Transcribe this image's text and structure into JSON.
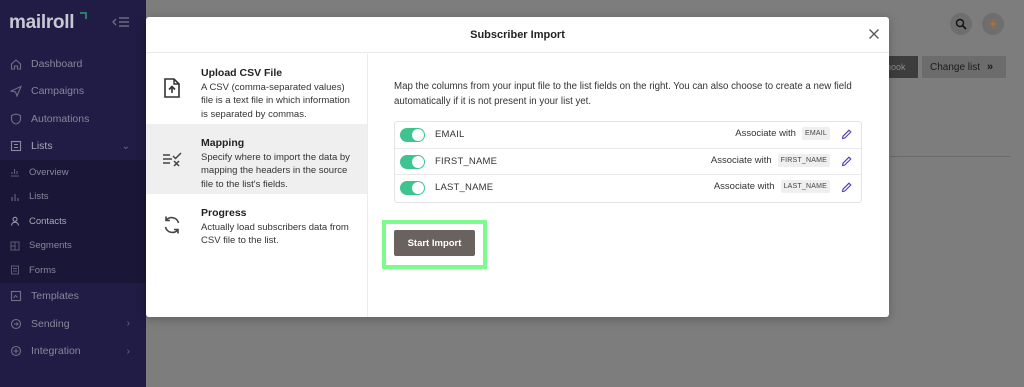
{
  "brand": {
    "name": "mailroll"
  },
  "sidebar": {
    "items": [
      {
        "label": "Dashboard",
        "icon": "home-icon"
      },
      {
        "label": "Campaigns",
        "icon": "send-icon"
      },
      {
        "label": "Automations",
        "icon": "shield-icon"
      },
      {
        "label": "Lists",
        "icon": "list-icon",
        "expanded": true
      }
    ],
    "sub_items": [
      {
        "label": "Overview",
        "icon": "chart-icon"
      },
      {
        "label": "Lists",
        "icon": "bar-icon"
      },
      {
        "label": "Contacts",
        "icon": "user-icon"
      },
      {
        "label": "Segments",
        "icon": "segment-icon"
      },
      {
        "label": "Forms",
        "icon": "form-icon"
      }
    ],
    "bottom_items": [
      {
        "label": "Templates",
        "icon": "template-icon"
      },
      {
        "label": "Sending",
        "icon": "sending-icon"
      },
      {
        "label": "Integration",
        "icon": "plug-icon"
      }
    ]
  },
  "background": {
    "change_list_label": "Change list",
    "dark_button_label": "hook"
  },
  "modal": {
    "title": "Subscriber Import",
    "steps": [
      {
        "title": "Upload CSV File",
        "desc": "A CSV (comma-separated values) file is a text file in which information is separated by commas.",
        "icon": "upload-file-icon"
      },
      {
        "title": "Mapping",
        "desc": "Specify where to import the data by mapping the headers in the source file to the list's fields.",
        "icon": "mapping-icon"
      },
      {
        "title": "Progress",
        "desc": "Actually load subscribers data from CSV file to the list.",
        "icon": "refresh-icon"
      }
    ],
    "intro": "Map the columns from your input file to the list fields on the right. You can also choose to create a new field automatically if it is not present in your list yet.",
    "fields": [
      {
        "name": "EMAIL",
        "associate_label": "Associate with",
        "tag": "EMAIL",
        "enabled": true
      },
      {
        "name": "FIRST_NAME",
        "associate_label": "Associate with",
        "tag": "FIRST_NAME",
        "enabled": true
      },
      {
        "name": "LAST_NAME",
        "associate_label": "Associate with",
        "tag": "LAST_NAME",
        "enabled": true
      }
    ],
    "start_button": "Start Import"
  },
  "colors": {
    "sidebar": "#201c45",
    "toggle": "#3ec48f",
    "highlight": "#7dfb8d",
    "button": "#6a625e"
  }
}
